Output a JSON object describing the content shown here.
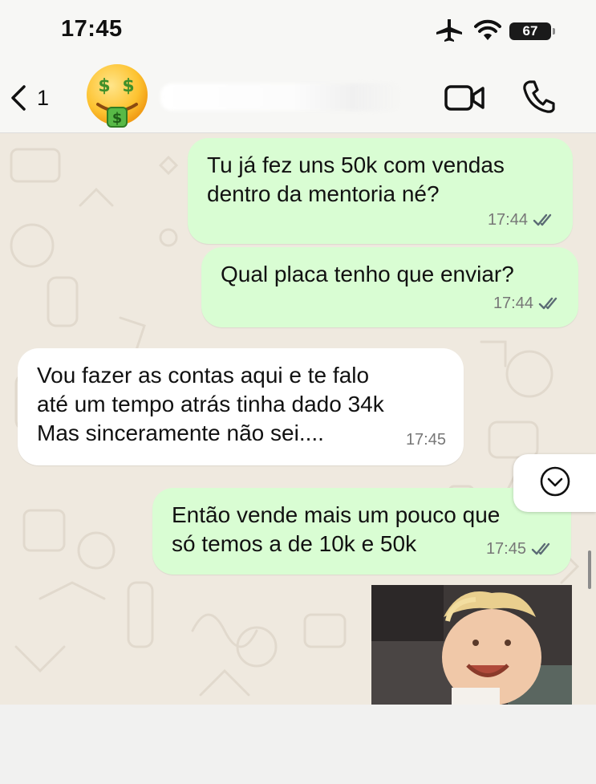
{
  "status_bar": {
    "time": "17:45",
    "battery": "67",
    "icons": [
      "airplane-icon",
      "wifi-icon",
      "battery-icon"
    ]
  },
  "header": {
    "back_count": "1",
    "avatar_icon": "money-mouth-face-icon",
    "actions": [
      "video-call-icon",
      "voice-call-icon"
    ]
  },
  "messages": [
    {
      "direction": "out",
      "text": "Tu já fez uns 50k com vendas\ndentro da mentoria né?",
      "time": "17:44",
      "status": "read"
    },
    {
      "direction": "out",
      "text": "Qual placa tenho que enviar?",
      "time": "17:44",
      "status": "read"
    },
    {
      "direction": "in",
      "text": "Vou fazer as contas aqui e te falo\naté um tempo atrás tinha dado 34k\nMas sinceramente não sei....",
      "time": "17:45"
    },
    {
      "direction": "out",
      "text": "Então vende mais um pouco que\nsó temos a de 10k e 50k",
      "time": "17:45",
      "status": "read"
    }
  ],
  "colors": {
    "outgoing_bubble": "#d9fdd3",
    "incoming_bubble": "#ffffff",
    "chat_background": "#efe9df",
    "ticks": "#5b6b74"
  }
}
